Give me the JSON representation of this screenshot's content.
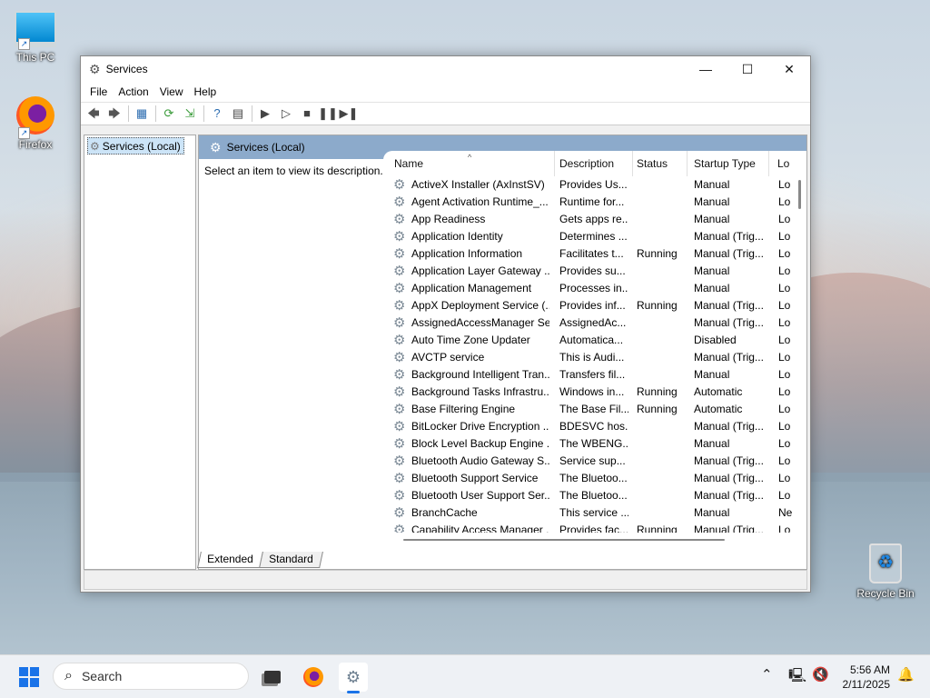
{
  "desktop": {
    "icons": [
      {
        "label": "This PC"
      },
      {
        "label": "Firefox"
      },
      {
        "label": "Recycle Bin"
      }
    ]
  },
  "window": {
    "title": "Services",
    "controls": {
      "minimize": "—",
      "maximize": "☐",
      "close": "✕"
    },
    "menu": [
      "File",
      "Action",
      "View",
      "Help"
    ],
    "tree_item": "Services (Local)",
    "header_title": "Services (Local)",
    "description_hint": "Select an item to view its description.",
    "columns": [
      "Name",
      "Description",
      "Status",
      "Startup Type",
      "Lo"
    ],
    "rows": [
      {
        "name": "ActiveX Installer (AxInstSV)",
        "description": "Provides Us...",
        "status": "",
        "startup": "Manual",
        "logon": "Lo"
      },
      {
        "name": "Agent Activation Runtime_...",
        "description": "Runtime for...",
        "status": "",
        "startup": "Manual",
        "logon": "Lo"
      },
      {
        "name": "App Readiness",
        "description": "Gets apps re...",
        "status": "",
        "startup": "Manual",
        "logon": "Lo"
      },
      {
        "name": "Application Identity",
        "description": "Determines ...",
        "status": "",
        "startup": "Manual (Trig...",
        "logon": "Lo"
      },
      {
        "name": "Application Information",
        "description": "Facilitates t...",
        "status": "Running",
        "startup": "Manual (Trig...",
        "logon": "Lo"
      },
      {
        "name": "Application Layer Gateway ...",
        "description": "Provides su...",
        "status": "",
        "startup": "Manual",
        "logon": "Lo"
      },
      {
        "name": "Application Management",
        "description": "Processes in...",
        "status": "",
        "startup": "Manual",
        "logon": "Lo"
      },
      {
        "name": "AppX Deployment Service (...",
        "description": "Provides inf...",
        "status": "Running",
        "startup": "Manual (Trig...",
        "logon": "Lo"
      },
      {
        "name": "AssignedAccessManager Se...",
        "description": "AssignedAc...",
        "status": "",
        "startup": "Manual (Trig...",
        "logon": "Lo"
      },
      {
        "name": "Auto Time Zone Updater",
        "description": "Automatica...",
        "status": "",
        "startup": "Disabled",
        "logon": "Lo"
      },
      {
        "name": "AVCTP service",
        "description": "This is Audi...",
        "status": "",
        "startup": "Manual (Trig...",
        "logon": "Lo"
      },
      {
        "name": "Background Intelligent Tran...",
        "description": "Transfers fil...",
        "status": "",
        "startup": "Manual",
        "logon": "Lo"
      },
      {
        "name": "Background Tasks Infrastru...",
        "description": "Windows in...",
        "status": "Running",
        "startup": "Automatic",
        "logon": "Lo"
      },
      {
        "name": "Base Filtering Engine",
        "description": "The Base Fil...",
        "status": "Running",
        "startup": "Automatic",
        "logon": "Lo"
      },
      {
        "name": "BitLocker Drive Encryption ...",
        "description": "BDESVC hos...",
        "status": "",
        "startup": "Manual (Trig...",
        "logon": "Lo"
      },
      {
        "name": "Block Level Backup Engine ...",
        "description": "The WBENG...",
        "status": "",
        "startup": "Manual",
        "logon": "Lo"
      },
      {
        "name": "Bluetooth Audio Gateway S...",
        "description": "Service sup...",
        "status": "",
        "startup": "Manual (Trig...",
        "logon": "Lo"
      },
      {
        "name": "Bluetooth Support Service",
        "description": "The Bluetoo...",
        "status": "",
        "startup": "Manual (Trig...",
        "logon": "Lo"
      },
      {
        "name": "Bluetooth User Support Ser...",
        "description": "The Bluetoo...",
        "status": "",
        "startup": "Manual (Trig...",
        "logon": "Lo"
      },
      {
        "name": "BranchCache",
        "description": "This service ...",
        "status": "",
        "startup": "Manual",
        "logon": "Ne"
      },
      {
        "name": "Capability Access Manager ...",
        "description": "Provides fac...",
        "status": "Running",
        "startup": "Manual (Trig...",
        "logon": "Lo"
      }
    ],
    "tabs": [
      "Extended",
      "Standard"
    ]
  },
  "taskbar": {
    "search_placeholder": "Search",
    "time": "5:56 AM",
    "date": "2/11/2025"
  }
}
